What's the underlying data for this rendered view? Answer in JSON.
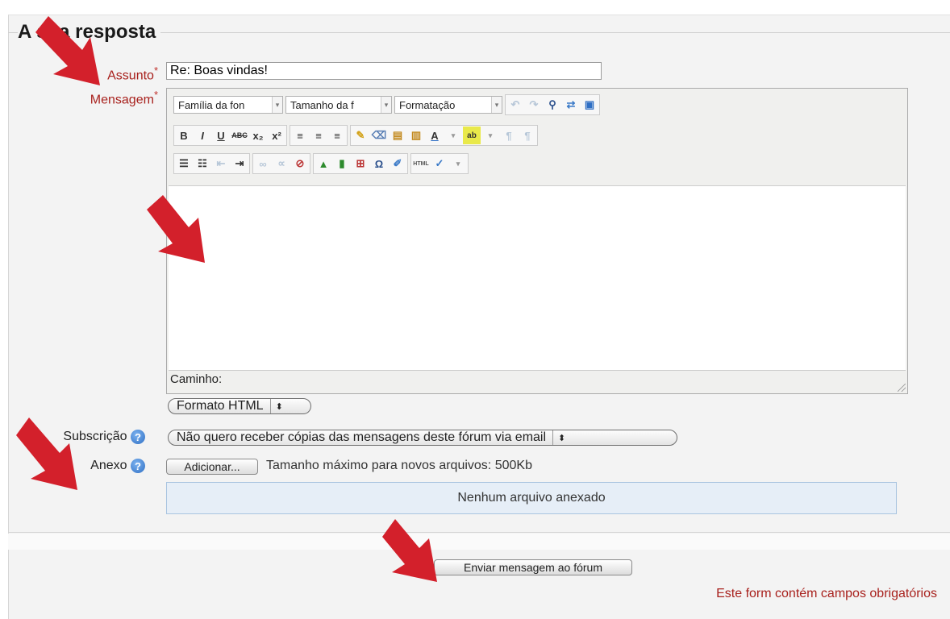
{
  "form": {
    "legend": "A sua resposta",
    "subject_label": "Assunto",
    "message_label": "Mensagem",
    "required_mark": "*",
    "subject_value": "Re: Boas vindas!",
    "format_value": "Formato HTML",
    "subscription_label": "Subscrição",
    "subscription_value": "Não quero receber cópias das mensagens deste fórum via email",
    "attachment_label": "Anexo",
    "add_button": "Adicionar...",
    "max_size": "Tamanho máximo para novos arquivos: 500Kb",
    "no_files": "Nenhum arquivo anexado",
    "submit_button": "Enviar mensagem ao fórum",
    "required_note": "Este form contém campos obrigatórios"
  },
  "editor": {
    "font_family": "Família da fon",
    "font_size": "Tamanho da f",
    "format": "Formatação",
    "path_label": "Caminho:"
  },
  "toolbar": {
    "bold": "B",
    "italic": "I",
    "underline": "U",
    "strike": "ABC",
    "subscript": "x₂",
    "superscript": "x²",
    "text_color": "A",
    "omega": "Ω",
    "html": "HTML"
  },
  "icons": {
    "help": "?",
    "updown": "⬍",
    "dropdown": "▾"
  },
  "colors": {
    "required": "#a8211d",
    "annotation_arrow": "#d3202b"
  }
}
